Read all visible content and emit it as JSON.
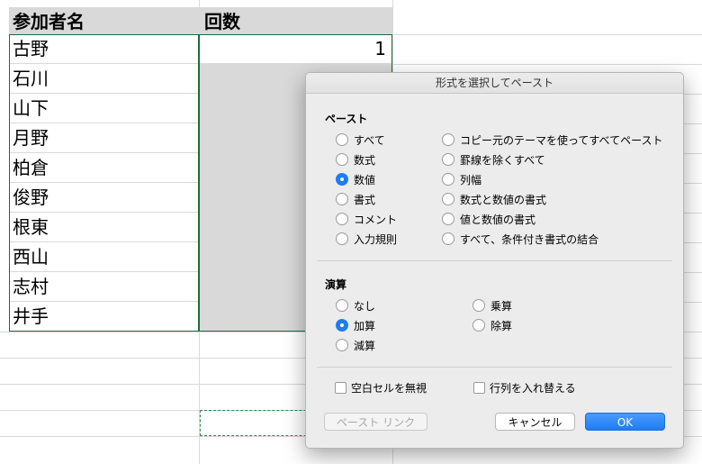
{
  "sheet": {
    "header": {
      "col_a": "参加者名",
      "col_b": "回数"
    },
    "rows": [
      {
        "name": "古野",
        "count": "1"
      },
      {
        "name": "石川",
        "count": ""
      },
      {
        "name": "山下",
        "count": ""
      },
      {
        "name": "月野",
        "count": ""
      },
      {
        "name": "柏倉",
        "count": ""
      },
      {
        "name": "俊野",
        "count": ""
      },
      {
        "name": "根東",
        "count": ""
      },
      {
        "name": "西山",
        "count": ""
      },
      {
        "name": "志村",
        "count": ""
      },
      {
        "name": "井手",
        "count": ""
      }
    ]
  },
  "dialog": {
    "title": "形式を選択してペースト",
    "paste_section": "ペースト",
    "paste_left": [
      "すべて",
      "数式",
      "数値",
      "書式",
      "コメント",
      "入力規則"
    ],
    "paste_right": [
      "コピー元のテーマを使ってすべてペースト",
      "罫線を除くすべて",
      "列幅",
      "数式と数値の書式",
      "値と数値の書式",
      "すべて、条件付き書式の結合"
    ],
    "paste_selected": "数値",
    "operation_section": "演算",
    "op_left": [
      "なし",
      "加算",
      "減算"
    ],
    "op_right": [
      "乗算",
      "除算"
    ],
    "op_selected": "加算",
    "skip_blanks": "空白セルを無視",
    "transpose": "行列を入れ替える",
    "paste_link_button": "ペースト リンク",
    "cancel_button": "キャンセル",
    "ok_button": "OK"
  },
  "colors": {
    "accent": "#1f7cf2",
    "header_fill": "#d9d9d9",
    "selection_border": "#1e6b3c"
  }
}
